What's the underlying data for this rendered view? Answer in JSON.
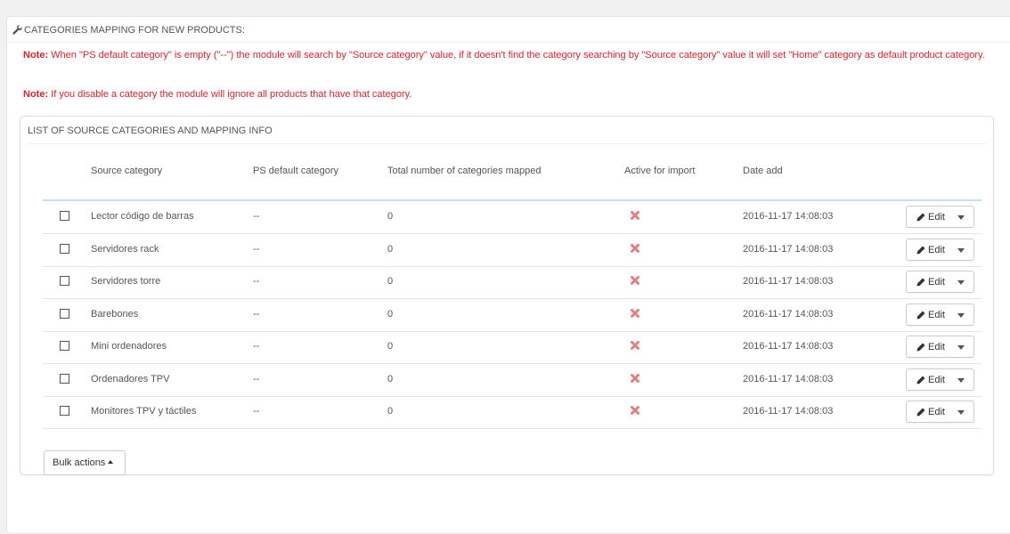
{
  "panel": {
    "title": "CATEGORIES MAPPING FOR NEW PRODUCTS:",
    "icon": "wrench-icon"
  },
  "notes": [
    {
      "label": "Note:",
      "text": " When \"PS default category\" is empty (\"--\") the module will search by \"Source category\" value, if it doesn't find the category searching by \"Source category\" value it will set \"Home\" category as default product category."
    },
    {
      "label": "Note:",
      "text": " If you disable a category the module will ignore all products that have that category."
    }
  ],
  "list": {
    "title": "LIST OF SOURCE CATEGORIES AND MAPPING INFO",
    "columns": [
      "Source category",
      "PS default category",
      "Total number of categories mapped",
      "Active for import",
      "Date add"
    ],
    "rows": [
      {
        "source": "Lector código de barras",
        "ps_default": "--",
        "total": "0",
        "active": false,
        "date": "2016-11-17 14:08:03"
      },
      {
        "source": "Servidores rack",
        "ps_default": "--",
        "total": "0",
        "active": false,
        "date": "2016-11-17 14:08:03"
      },
      {
        "source": "Servidores torre",
        "ps_default": "--",
        "total": "0",
        "active": false,
        "date": "2016-11-17 14:08:03"
      },
      {
        "source": "Barebones",
        "ps_default": "--",
        "total": "0",
        "active": false,
        "date": "2016-11-17 14:08:03"
      },
      {
        "source": "Mini ordenadores",
        "ps_default": "--",
        "total": "0",
        "active": false,
        "date": "2016-11-17 14:08:03"
      },
      {
        "source": "Ordenadores TPV",
        "ps_default": "--",
        "total": "0",
        "active": false,
        "date": "2016-11-17 14:08:03"
      },
      {
        "source": "Monitores TPV y táctiles",
        "ps_default": "--",
        "total": "0",
        "active": false,
        "date": "2016-11-17 14:08:03"
      }
    ],
    "edit_label": "Edit",
    "bulk_label": "Bulk actions"
  },
  "colors": {
    "note_red": "#e0222b",
    "inactive_x": "#e57d80",
    "header_rule": "#bfe4ee"
  }
}
